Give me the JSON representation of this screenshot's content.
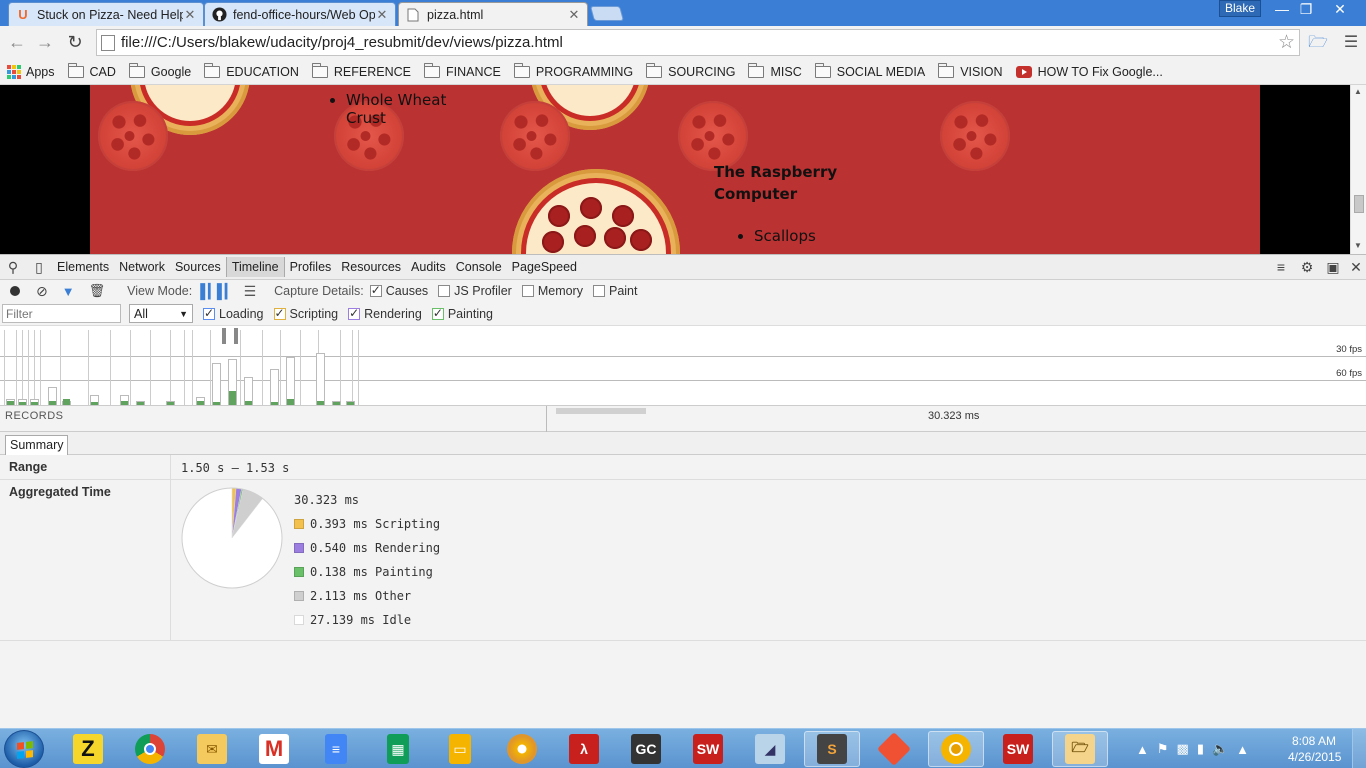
{
  "browser": {
    "tabs": [
      {
        "title": "Stuck on Pizza- Need Help",
        "favicon": "udacity-icon"
      },
      {
        "title": "fend-office-hours/Web Op",
        "favicon": "github-icon"
      },
      {
        "title": "pizza.html",
        "favicon": "page-icon"
      }
    ],
    "user": "Blake",
    "url": "file:///C:/Users/blakew/udacity/proj4_resubmit/dev/views/pizza.html"
  },
  "bookmarks": [
    {
      "label": "Apps",
      "icon": "apps-icon"
    },
    {
      "label": "CAD",
      "icon": "folder-icon"
    },
    {
      "label": "Google",
      "icon": "folder-icon"
    },
    {
      "label": "EDUCATION",
      "icon": "folder-icon"
    },
    {
      "label": "REFERENCE",
      "icon": "folder-icon"
    },
    {
      "label": "FINANCE",
      "icon": "folder-icon"
    },
    {
      "label": "PROGRAMMING",
      "icon": "folder-icon"
    },
    {
      "label": "SOURCING",
      "icon": "folder-icon"
    },
    {
      "label": "MISC",
      "icon": "folder-icon"
    },
    {
      "label": "SOCIAL MEDIA",
      "icon": "folder-icon"
    },
    {
      "label": "VISION",
      "icon": "folder-icon"
    },
    {
      "label": "HOW TO Fix Google...",
      "icon": "youtube-icon"
    }
  ],
  "page": {
    "item_a": "Whole Wheat",
    "item_a2": "Crust",
    "pizza_name_1": "The Raspberry",
    "pizza_name_2": "Computer",
    "item_b": "Scallops",
    "background_color": "#bb3232"
  },
  "devtools": {
    "tabs": [
      "Elements",
      "Network",
      "Sources",
      "Timeline",
      "Profiles",
      "Resources",
      "Audits",
      "Console",
      "PageSpeed"
    ],
    "selected_tab": "Timeline",
    "view_mode_label": "View Mode:",
    "capture_label": "Capture Details:",
    "capture_options": [
      {
        "label": "Causes",
        "checked": true
      },
      {
        "label": "JS Profiler",
        "checked": false
      },
      {
        "label": "Memory",
        "checked": false
      },
      {
        "label": "Paint",
        "checked": false
      }
    ],
    "filter_placeholder": "Filter",
    "filter_select": "All",
    "categories": [
      {
        "label": "Loading",
        "checked": true,
        "color": "#5b8ef0"
      },
      {
        "label": "Scripting",
        "checked": true,
        "color": "#f2c14e"
      },
      {
        "label": "Rendering",
        "checked": true,
        "color": "#9b7ee0"
      },
      {
        "label": "Painting",
        "checked": true,
        "color": "#6abf69"
      }
    ],
    "fps_30": "30 fps",
    "fps_60": "60 fps",
    "records_label": "RECORDS",
    "selection_ms": "30.323 ms",
    "summary_tab": "Summary",
    "range_label": "Range",
    "range_value": "1.50 s – 1.53 s",
    "aggregated_label": "Aggregated Time",
    "total": "30.323 ms",
    "breakdown": [
      {
        "text": "0.393 ms Scripting",
        "value": 0.393,
        "color": "#f2c14e"
      },
      {
        "text": "0.540 ms Rendering",
        "value": 0.54,
        "color": "#9b7ee0"
      },
      {
        "text": "0.138 ms Painting",
        "value": 0.138,
        "color": "#6abf69"
      },
      {
        "text": "2.113 ms Other",
        "value": 2.113,
        "color": "#cfcfcf"
      },
      {
        "text": "27.139 ms Idle",
        "value": 27.139,
        "color": "#ffffff"
      }
    ]
  },
  "taskbar": {
    "apps": [
      "zune-icon",
      "chrome-icon",
      "outlook-icon",
      "gmail-icon",
      "docs-icon",
      "sheets-icon",
      "slides-icon",
      "picasa-icon",
      "acrobat-icon",
      "gc-icon",
      "solidworks-icon",
      "drive-icon",
      "sublime-icon",
      "git-icon",
      "chrome-canary-icon",
      "solidworks2-icon",
      "explorer-icon"
    ],
    "time": "8:08 AM",
    "date": "4/26/2015"
  }
}
